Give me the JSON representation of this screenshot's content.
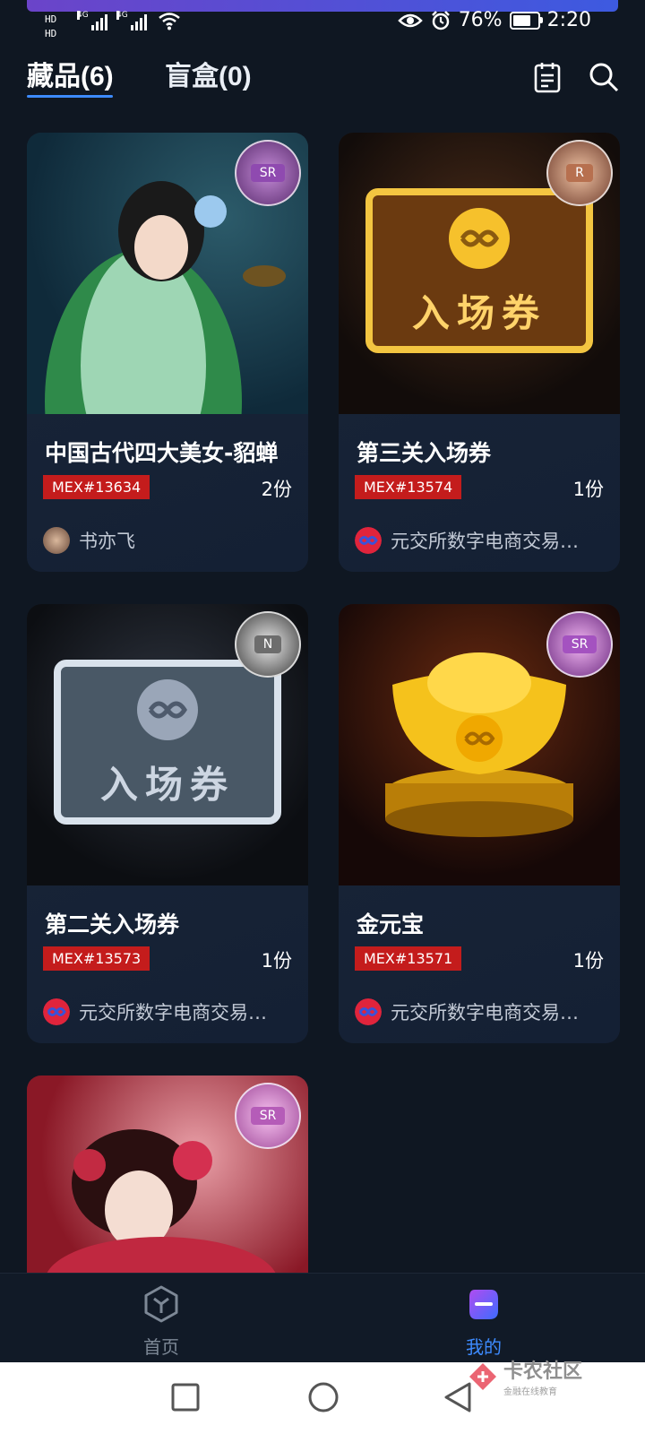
{
  "status_bar": {
    "hd1": "HD",
    "hd2": "HD",
    "net1": "4G",
    "net2": "4G",
    "battery_percent": "76%",
    "battery_level": 0.76,
    "time": "2:20"
  },
  "tabs": [
    {
      "label": "藏品(6)",
      "active": true
    },
    {
      "label": "盲盒(0)",
      "active": false
    }
  ],
  "cards": [
    {
      "title": "中国古代四大美女-貂蝉",
      "code": "MEX#13634",
      "quantity": "2份",
      "creator": "书亦飞",
      "rarity": "SR"
    },
    {
      "title": "第三关入场券",
      "code": "MEX#13574",
      "quantity": "1份",
      "creator": "元交所数字电商交易…",
      "rarity": "R",
      "ticket_text": "入场券"
    },
    {
      "title": "第二关入场券",
      "code": "MEX#13573",
      "quantity": "1份",
      "creator": "元交所数字电商交易…",
      "rarity": "N",
      "ticket_text": "入场券"
    },
    {
      "title": "金元宝",
      "code": "MEX#13571",
      "quantity": "1份",
      "creator": "元交所数字电商交易…",
      "rarity": "SR"
    },
    {
      "rarity": "SR"
    }
  ],
  "bottom_nav": [
    {
      "label": "首页",
      "icon": "cube-icon",
      "active": false,
      "color": "#7d8896"
    },
    {
      "label": "我的",
      "icon": "profile-icon",
      "active": true,
      "color": "#3d8bff"
    }
  ],
  "watermark": {
    "title": "卡农社区",
    "subtitle": "金融在线教育"
  }
}
